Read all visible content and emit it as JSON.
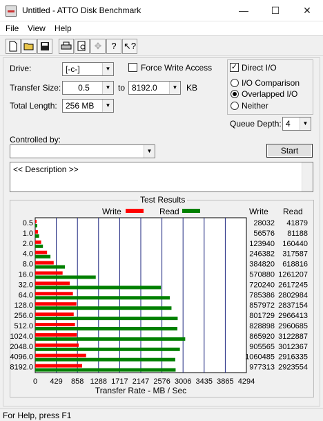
{
  "window": {
    "title": "Untitled - ATTO Disk Benchmark",
    "minimize": "—",
    "maximize": "☐",
    "close": "✕"
  },
  "menu": {
    "file": "File",
    "view": "View",
    "help": "Help"
  },
  "toolbar": {
    "icons": [
      "new-file-icon",
      "open-folder-icon",
      "save-icon",
      "print-icon",
      "print-preview-icon",
      "move-icon",
      "help-icon",
      "context-help-icon"
    ]
  },
  "form": {
    "drive_label": "Drive:",
    "drive_value": "[-c-]",
    "force_write_label": "Force Write Access",
    "force_write_checked": false,
    "direct_io_label": "Direct I/O",
    "direct_io_checked": true,
    "transfer_size_label": "Transfer Size:",
    "transfer_from": "0.5",
    "to_label": "to",
    "transfer_to": "8192.0",
    "kb_label": "KB",
    "io_comparison_label": "I/O Comparison",
    "overlapped_io_label": "Overlapped I/O",
    "neither_label": "Neither",
    "selected_io_mode": "Overlapped I/O",
    "total_length_label": "Total Length:",
    "total_length_value": "256 MB",
    "queue_depth_label": "Queue Depth:",
    "queue_depth_value": "4",
    "controlled_by_label": "Controlled by:",
    "controlled_by_value": "",
    "start_label": "Start",
    "description_text": "<< Description >>"
  },
  "results": {
    "title": "Test Results",
    "write_label": "Write",
    "read_label": "Read",
    "write_col": "Write",
    "read_col": "Read",
    "x_axis_label": "Transfer Rate - MB / Sec",
    "write_color": "#ff0000",
    "read_color": "#008000"
  },
  "chart_data": {
    "type": "bar",
    "orientation": "horizontal",
    "title": "Test Results",
    "xlabel": "Transfer Rate - MB / Sec",
    "xlim": [
      0,
      4294
    ],
    "x_ticks": [
      "0",
      "429",
      "858",
      "1288",
      "1717",
      "2147",
      "2576",
      "3006",
      "3435",
      "3865",
      "4294"
    ],
    "categories": [
      "0.5",
      "1.0",
      "2.0",
      "4.0",
      "8.0",
      "16.0",
      "32.0",
      "64.0",
      "128.0",
      "256.0",
      "512.0",
      "1024.0",
      "2048.0",
      "4096.0",
      "8192.0"
    ],
    "series": [
      {
        "name": "Write",
        "color": "#ff0000",
        "values": [
          27,
          55,
          121,
          241,
          376,
          557,
          703,
          767,
          838,
          783,
          809,
          846,
          884,
          1035,
          954
        ]
      },
      {
        "name": "Read",
        "color": "#008000",
        "values": [
          41,
          79,
          157,
          310,
          604,
          1231,
          2556,
          2737,
          2771,
          2897,
          2891,
          3050,
          2942,
          2848,
          2855
        ]
      }
    ],
    "write_text": [
      "28032",
      "56576",
      "123940",
      "246382",
      "384820",
      "570880",
      "720240",
      "785386",
      "857972",
      "801729",
      "828898",
      "865920",
      "905565",
      "1060485",
      "977313"
    ],
    "read_text": [
      "41879",
      "81188",
      "160440",
      "317587",
      "618816",
      "1261207",
      "2617245",
      "2802984",
      "2837154",
      "2966413",
      "2960685",
      "3122887",
      "3012367",
      "2916335",
      "2923554"
    ],
    "grid": true,
    "legend": "top-center"
  },
  "status": {
    "text": "For Help, press F1"
  }
}
